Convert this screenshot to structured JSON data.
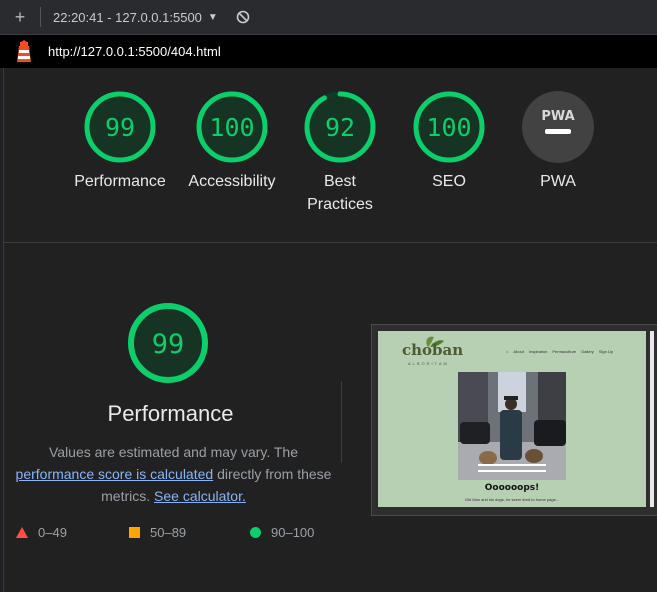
{
  "topbar": {
    "session": "22:20:41 - 127.0.0.1:5500",
    "new_tab_icon": "plus-icon",
    "block_icon": "block-icon",
    "caret_icon": "caret-down-icon"
  },
  "urlbar": {
    "url": "http://127.0.0.1:5500/404.html",
    "icon": "lighthouse-icon"
  },
  "gauges": [
    {
      "label": "Performance",
      "score": "99",
      "value": 0.99
    },
    {
      "label": "Accessibility",
      "score": "100",
      "value": 1.0
    },
    {
      "label": "Best Practices",
      "score": "92",
      "value": 0.92
    },
    {
      "label": "SEO",
      "score": "100",
      "value": 1.0
    },
    {
      "label": "PWA",
      "badge": "PWA"
    }
  ],
  "performance": {
    "score": "99",
    "value": 0.99,
    "title": "Performance",
    "desc_before": "Values are estimated and may vary. The ",
    "desc_link1": "performance score is calculated",
    "desc_mid": " directly from these metrics. ",
    "desc_link2": "See calculator."
  },
  "legend": [
    {
      "range": "0–49",
      "shape": "triangle",
      "color": "#ff4e42"
    },
    {
      "range": "50–89",
      "shape": "square",
      "color": "#ffa400"
    },
    {
      "range": "90–100",
      "shape": "circle",
      "color": "#0cce6b"
    }
  ],
  "screenshot": {
    "logo": "choban",
    "logo_sub": "ALBORITAM",
    "nav": [
      "About",
      "Inspiration",
      "Permaculture",
      "Gallery",
      "Sign Up"
    ],
    "heading": "Oooooops!",
    "subtext": "Old Man and his dogs, he seem tired to home page..."
  },
  "colors": {
    "pass": "#0cce6b",
    "pass_track": "#0c3d26",
    "pass_fill": "#163323",
    "na": "#424242",
    "link": "#8ab4f8"
  }
}
